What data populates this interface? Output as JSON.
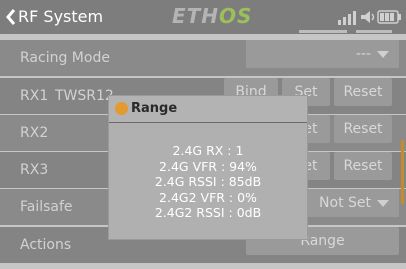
{
  "header": {
    "title": "RF System",
    "logo_part1": "ETH",
    "logo_part2": "OS"
  },
  "rows": [
    {
      "label": "Racing Mode",
      "select_value": "---"
    },
    {
      "label": "RX1",
      "sublabel": "TWSR12",
      "buttons": [
        "Bind",
        "Set",
        "Reset"
      ]
    },
    {
      "label": "RX2",
      "buttons": [
        "Set",
        "Reset"
      ]
    },
    {
      "label": "RX3",
      "buttons": [
        "Set",
        "Reset"
      ]
    },
    {
      "label": "Failsafe",
      "select_value": "Not Set"
    },
    {
      "label": "Actions",
      "button": "Range"
    }
  ],
  "modal": {
    "title": "Range",
    "lines": [
      "2.4G RX : 1",
      "2.4G VFR : 94%",
      "2.4G RSSI : 85dB",
      "2.4G2 VFR : 0%",
      "2.4G2 RSSI : 0dB"
    ]
  },
  "colors": {
    "accent": "#e39a2e",
    "logo_green": "#9bbf5a"
  }
}
